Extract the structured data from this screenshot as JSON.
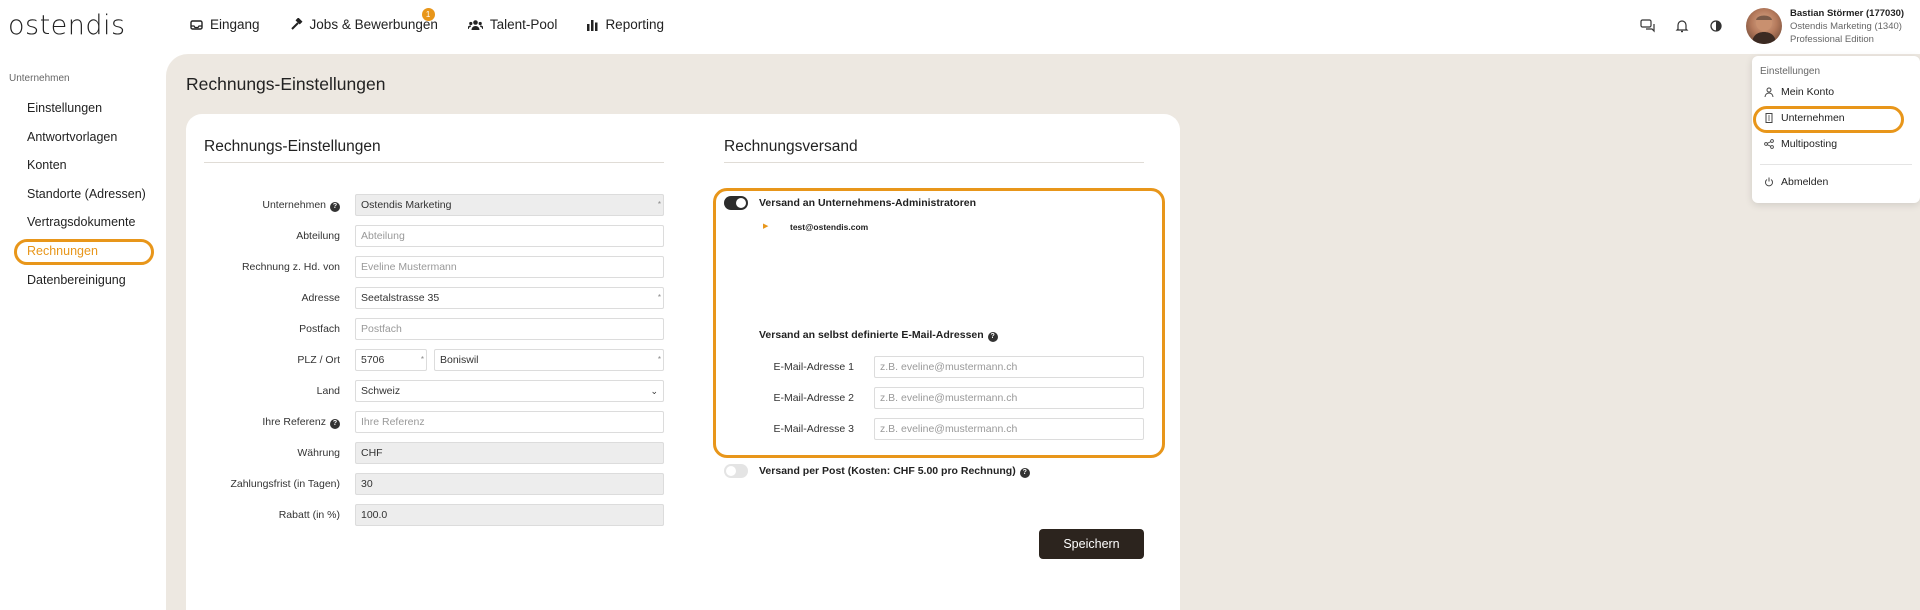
{
  "brand": {
    "logo": "ostendis",
    "accent": "#e8961a"
  },
  "nav": {
    "items": [
      {
        "label": "Eingang",
        "icon": "inbox-icon"
      },
      {
        "label": "Jobs & Bewerbungen",
        "icon": "hammer-icon",
        "badge": "1"
      },
      {
        "label": "Talent-Pool",
        "icon": "users-icon"
      },
      {
        "label": "Reporting",
        "icon": "bar-chart-icon"
      }
    ]
  },
  "user": {
    "name": "Bastian Störmer (177030)",
    "company": "Ostendis Marketing (1340)",
    "edition": "Professional Edition"
  },
  "sidebar": {
    "title": "Unternehmen",
    "items": [
      "Einstellungen",
      "Antwortvorlagen",
      "Konten",
      "Standorte (Adressen)",
      "Vertragsdokumente",
      "Rechnungen",
      "Datenbereinigung"
    ],
    "active": "Rechnungen"
  },
  "page": {
    "title": "Rechnungs-Einstellungen"
  },
  "billing": {
    "title": "Rechnungs-Einstellungen",
    "fields": {
      "unternehmen": {
        "label": "Unternehmen",
        "value": "Ostendis Marketing"
      },
      "abteilung": {
        "label": "Abteilung",
        "placeholder": "Abteilung"
      },
      "hdvon": {
        "label": "Rechnung z. Hd. von",
        "placeholder": "Eveline Mustermann"
      },
      "adresse": {
        "label": "Adresse",
        "value": "Seetalstrasse 35"
      },
      "postfach": {
        "label": "Postfach",
        "placeholder": "Postfach"
      },
      "plzort": {
        "label": "PLZ / Ort",
        "plz": "5706",
        "ort": "Boniswil"
      },
      "land": {
        "label": "Land",
        "value": "Schweiz"
      },
      "referenz": {
        "label": "Ihre Referenz",
        "placeholder": "Ihre Referenz"
      },
      "waehrung": {
        "label": "Währung",
        "value": "CHF"
      },
      "zahlungsfrist": {
        "label": "Zahlungsfrist (in Tagen)",
        "value": "30"
      },
      "rabatt": {
        "label": "Rabatt (in %)",
        "value": "100.0"
      }
    }
  },
  "versand": {
    "title": "Rechnungsversand",
    "admins": {
      "label": "Versand an Unternehmens-Administratoren",
      "enabled": true,
      "email": "test@ostendis.com"
    },
    "custom": {
      "label": "Versand an selbst definierte E-Mail-Adressen",
      "fields": [
        {
          "label": "E-Mail-Adresse 1",
          "placeholder": "z.B. eveline@mustermann.ch"
        },
        {
          "label": "E-Mail-Adresse 2",
          "placeholder": "z.B. eveline@mustermann.ch"
        },
        {
          "label": "E-Mail-Adresse 3",
          "placeholder": "z.B. eveline@mustermann.ch"
        }
      ]
    },
    "post": {
      "label": "Versand per Post (Kosten: CHF 5.00 pro Rechnung)",
      "enabled": false
    }
  },
  "save_label": "Speichern",
  "menu": {
    "title": "Einstellungen",
    "items": [
      "Mein Konto",
      "Unternehmen",
      "Multiposting",
      "Abmelden"
    ]
  }
}
